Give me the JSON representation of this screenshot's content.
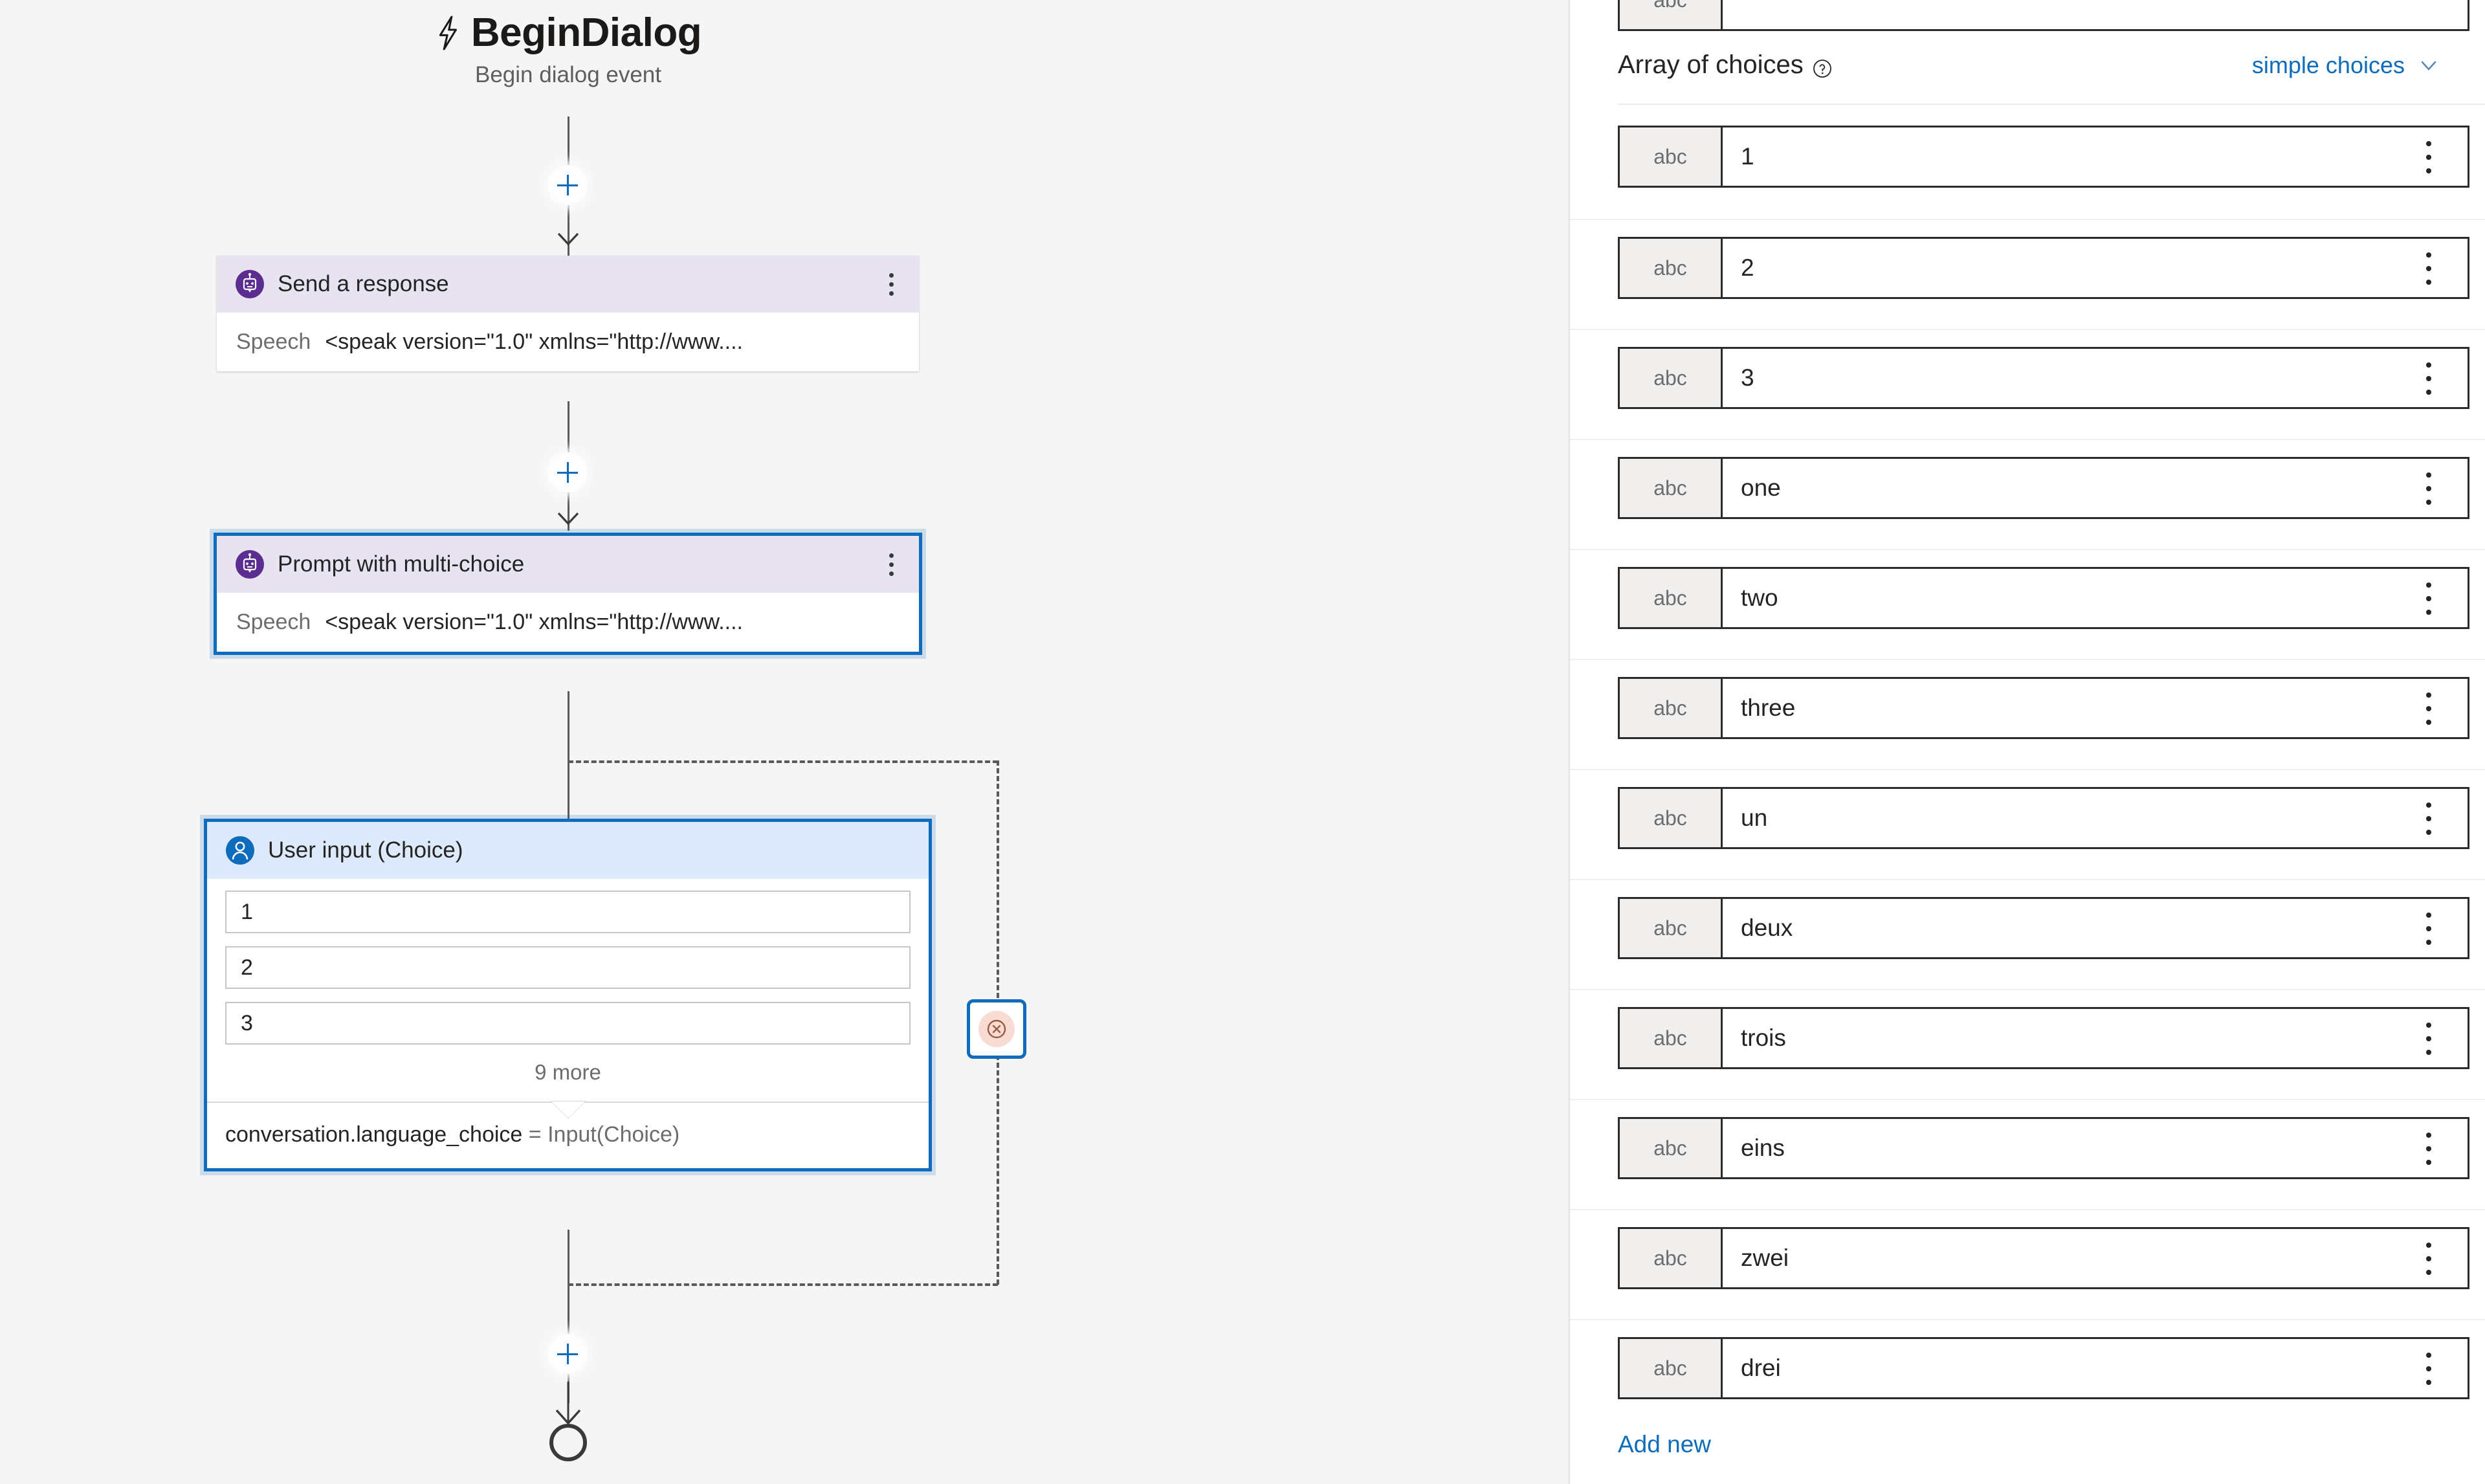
{
  "canvas": {
    "trigger": {
      "icon": "lightning-bolt-icon",
      "title": "BeginDialog",
      "subtitle": "Begin dialog event"
    },
    "nodes": [
      {
        "icon": "bot-icon",
        "title": "Send a response",
        "body_label": "Speech",
        "body_value": "<speak version=\"1.0\" xmlns=\"http://www....",
        "selected": false
      },
      {
        "icon": "bot-icon",
        "title": "Prompt with multi-choice",
        "body_label": "Speech",
        "body_value": "<speak version=\"1.0\" xmlns=\"http://www....",
        "selected": true
      }
    ],
    "user_input": {
      "icon": "person-icon",
      "title": "User input (Choice)",
      "choices": [
        "1",
        "2",
        "3"
      ],
      "more_label": "9 more",
      "assignment_variable": "conversation.language_choice",
      "assignment_operator": " = ",
      "assignment_value": "Input(Choice)"
    },
    "error_node": {
      "icon": "error-circle-icon"
    },
    "end_node": {
      "icon": "end-circle-icon"
    },
    "add_buttons": [
      "add-step-1",
      "add-step-2",
      "add-step-3"
    ],
    "colors": {
      "selection": "#0f6cbd",
      "bot_header": "#e7e3f0",
      "user_header": "#dceafb",
      "bot_icon": "#5b2d90",
      "user_icon": "#0f6cbd",
      "error": "#d4735a",
      "canvas_bg": "#f5f5f5"
    }
  },
  "panel": {
    "title": "Array of choices",
    "help_icon": "help-circle-icon",
    "mode_label": "simple choices",
    "mode_chevron": "chevron-down-icon",
    "type_badge": "abc",
    "cut_off_row_value": "",
    "choices": [
      "1",
      "2",
      "3",
      "one",
      "two",
      "three",
      "un",
      "deux",
      "trois",
      "eins",
      "zwei",
      "drei"
    ],
    "add_new_label": "Add new",
    "row_menu_icon": "more-vertical-icon"
  }
}
